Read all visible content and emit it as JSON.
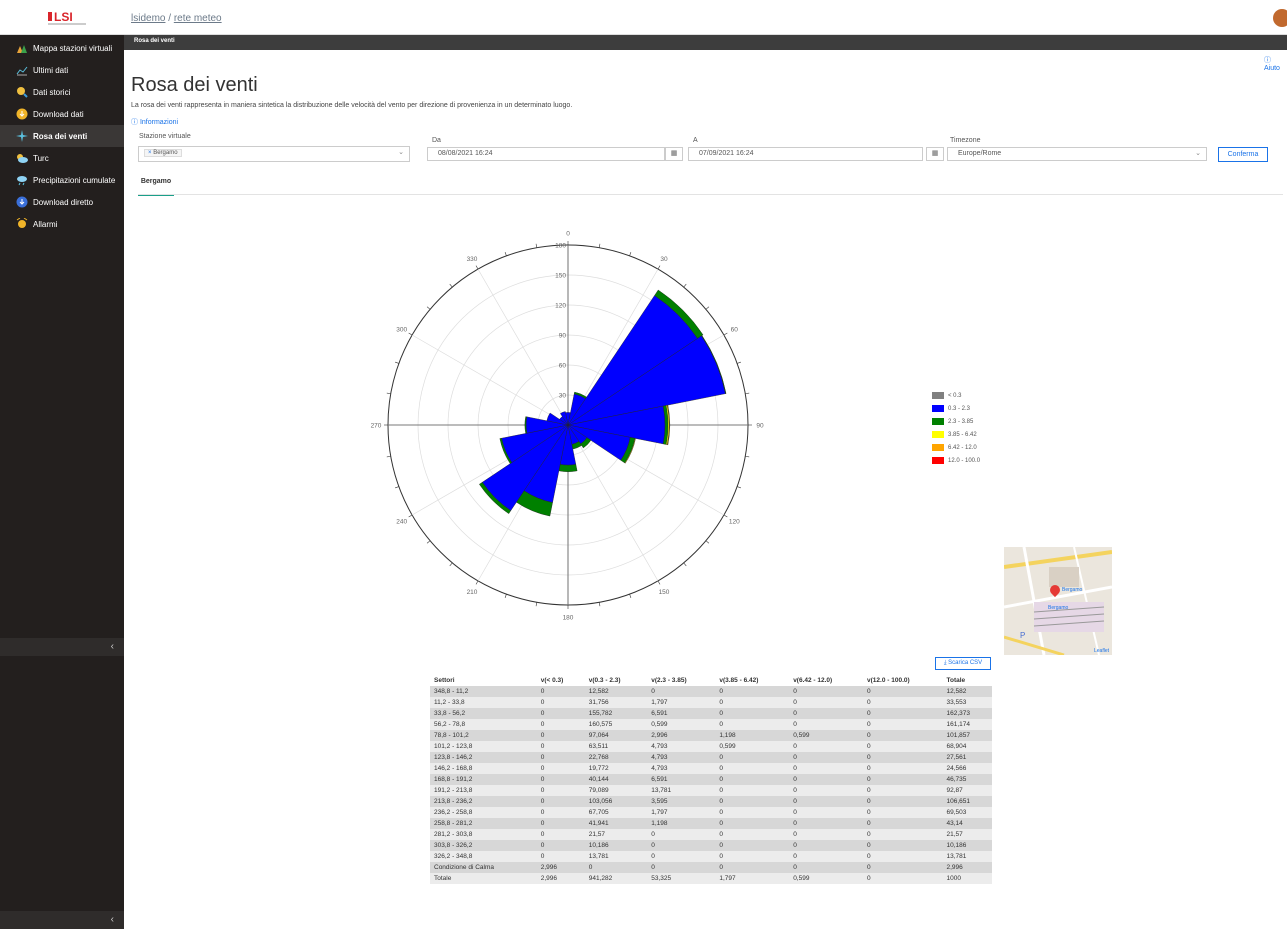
{
  "app": {
    "breadcrumb_org": "lsidemo",
    "breadcrumb_sep": "/",
    "breadcrumb_net": "rete meteo",
    "help_label": "Aiuto"
  },
  "sidebar": {
    "items": [
      {
        "label": "Mappa stazioni virtuali",
        "icon": "map-stations-icon"
      },
      {
        "label": "Ultimi dati",
        "icon": "line-chart-icon"
      },
      {
        "label": "Dati storici",
        "icon": "history-search-icon"
      },
      {
        "label": "Download dati",
        "icon": "download-icon"
      },
      {
        "label": "Rosa dei venti",
        "icon": "wind-rose-icon",
        "active": true
      },
      {
        "label": "Turc",
        "icon": "cloud-sun-icon"
      },
      {
        "label": "Precipitazioni cumulate",
        "icon": "rain-icon"
      },
      {
        "label": "Download diretto",
        "icon": "direct-download-icon"
      },
      {
        "label": "Allarmi",
        "icon": "alarm-icon"
      }
    ],
    "collapse_glyph": "‹"
  },
  "page": {
    "bar_title": "Rosa dei venti",
    "title": "Rosa dei venti",
    "description": "La rosa dei venti rappresenta in maniera sintetica la distribuzione delle velocità del vento per direzione di provenienza in un determinato luogo.",
    "info_link": "Informazioni"
  },
  "filters": {
    "station_label": "Stazione virtuale",
    "station_value": "Bergamo",
    "from_label": "Da",
    "from_value": "08/08/2021 16:24",
    "to_label": "A",
    "to_value": "07/09/2021 16:24",
    "tz_label": "Timezone",
    "tz_value": "Europe/Rome",
    "confirm_label": "Conferma"
  },
  "tabs": [
    {
      "label": "Bergamo",
      "active": true
    }
  ],
  "chart_data": {
    "type": "wind-rose",
    "radial_ticks": [
      30,
      60,
      90,
      120,
      150,
      180
    ],
    "rmax": 180,
    "angle_ticks": [
      0,
      30,
      60,
      90,
      120,
      150,
      180,
      210,
      240,
      270,
      300,
      330
    ],
    "series": [
      {
        "name": "< 0.3",
        "color": "#808080"
      },
      {
        "name": "0.3 - 2.3",
        "color": "#0000ff"
      },
      {
        "name": "2.3 - 3.85",
        "color": "#008000"
      },
      {
        "name": "3.85 - 6.42",
        "color": "#ffff00"
      },
      {
        "name": "6.42 - 12.0",
        "color": "#ffa500"
      },
      {
        "name": "12.0 - 100.0",
        "color": "#ff0000"
      }
    ],
    "sectors": [
      {
        "dir": 0,
        "values": [
          0,
          12.582,
          0,
          0,
          0,
          0
        ]
      },
      {
        "dir": 22.5,
        "values": [
          0,
          31.756,
          1.797,
          0,
          0,
          0
        ]
      },
      {
        "dir": 45,
        "values": [
          0,
          155.782,
          6.591,
          0,
          0,
          0
        ]
      },
      {
        "dir": 67.5,
        "values": [
          0,
          160.575,
          0.599,
          0,
          0,
          0
        ]
      },
      {
        "dir": 90,
        "values": [
          0,
          97.064,
          2.996,
          1.198,
          0.599,
          0
        ]
      },
      {
        "dir": 112.5,
        "values": [
          0,
          63.511,
          4.793,
          0.599,
          0,
          0
        ]
      },
      {
        "dir": 135,
        "values": [
          0,
          22.768,
          4.793,
          0,
          0,
          0
        ]
      },
      {
        "dir": 157.5,
        "values": [
          0,
          19.772,
          4.793,
          0,
          0,
          0
        ]
      },
      {
        "dir": 180,
        "values": [
          0,
          40.144,
          6.591,
          0,
          0,
          0
        ]
      },
      {
        "dir": 202.5,
        "values": [
          0,
          79.089,
          13.781,
          0,
          0,
          0
        ]
      },
      {
        "dir": 225,
        "values": [
          0,
          103.056,
          3.595,
          0,
          0,
          0
        ]
      },
      {
        "dir": 247.5,
        "values": [
          0,
          67.705,
          1.797,
          0,
          0,
          0
        ]
      },
      {
        "dir": 270,
        "values": [
          0,
          41.941,
          1.198,
          0,
          0,
          0
        ]
      },
      {
        "dir": 292.5,
        "values": [
          0,
          21.57,
          0,
          0,
          0,
          0
        ]
      },
      {
        "dir": 315,
        "values": [
          0,
          10.186,
          0,
          0,
          0,
          0
        ]
      },
      {
        "dir": 337.5,
        "values": [
          0,
          13.781,
          0,
          0,
          0,
          0
        ]
      }
    ]
  },
  "map": {
    "labels": [
      "Bergamo",
      "Bergamo"
    ],
    "attribution": "Leaflet",
    "parking": "P"
  },
  "table": {
    "csv_label": "Scarica CSV",
    "headers": [
      "Settori",
      "v(< 0.3)",
      "v(0.3 - 2.3)",
      "v(2.3 - 3.85)",
      "v(3.85 - 6.42)",
      "v(6.42 - 12.0)",
      "v(12.0 - 100.0)",
      "Totale"
    ],
    "rows": [
      [
        "348,8 - 11,2",
        "0",
        "12,582",
        "0",
        "0",
        "0",
        "0",
        "12,582"
      ],
      [
        "11,2 - 33,8",
        "0",
        "31,756",
        "1,797",
        "0",
        "0",
        "0",
        "33,553"
      ],
      [
        "33,8 - 56,2",
        "0",
        "155,782",
        "6,591",
        "0",
        "0",
        "0",
        "162,373"
      ],
      [
        "56,2 - 78,8",
        "0",
        "160,575",
        "0,599",
        "0",
        "0",
        "0",
        "161,174"
      ],
      [
        "78,8 - 101,2",
        "0",
        "97,064",
        "2,996",
        "1,198",
        "0,599",
        "0",
        "101,857"
      ],
      [
        "101,2 - 123,8",
        "0",
        "63,511",
        "4,793",
        "0,599",
        "0",
        "0",
        "68,904"
      ],
      [
        "123,8 - 146,2",
        "0",
        "22,768",
        "4,793",
        "0",
        "0",
        "0",
        "27,561"
      ],
      [
        "146,2 - 168,8",
        "0",
        "19,772",
        "4,793",
        "0",
        "0",
        "0",
        "24,566"
      ],
      [
        "168,8 - 191,2",
        "0",
        "40,144",
        "6,591",
        "0",
        "0",
        "0",
        "46,735"
      ],
      [
        "191,2 - 213,8",
        "0",
        "79,089",
        "13,781",
        "0",
        "0",
        "0",
        "92,87"
      ],
      [
        "213,8 - 236,2",
        "0",
        "103,056",
        "3,595",
        "0",
        "0",
        "0",
        "106,651"
      ],
      [
        "236,2 - 258,8",
        "0",
        "67,705",
        "1,797",
        "0",
        "0",
        "0",
        "69,503"
      ],
      [
        "258,8 - 281,2",
        "0",
        "41,941",
        "1,198",
        "0",
        "0",
        "0",
        "43,14"
      ],
      [
        "281,2 - 303,8",
        "0",
        "21,57",
        "0",
        "0",
        "0",
        "0",
        "21,57"
      ],
      [
        "303,8 - 326,2",
        "0",
        "10,186",
        "0",
        "0",
        "0",
        "0",
        "10,186"
      ],
      [
        "326,2 - 348,8",
        "0",
        "13,781",
        "0",
        "0",
        "0",
        "0",
        "13,781"
      ],
      [
        "Condizione di Calma",
        "2,996",
        "0",
        "0",
        "0",
        "0",
        "0",
        "2,996"
      ],
      [
        "Totale",
        "2,996",
        "941,282",
        "53,325",
        "1,797",
        "0,599",
        "0",
        "1000"
      ]
    ]
  }
}
